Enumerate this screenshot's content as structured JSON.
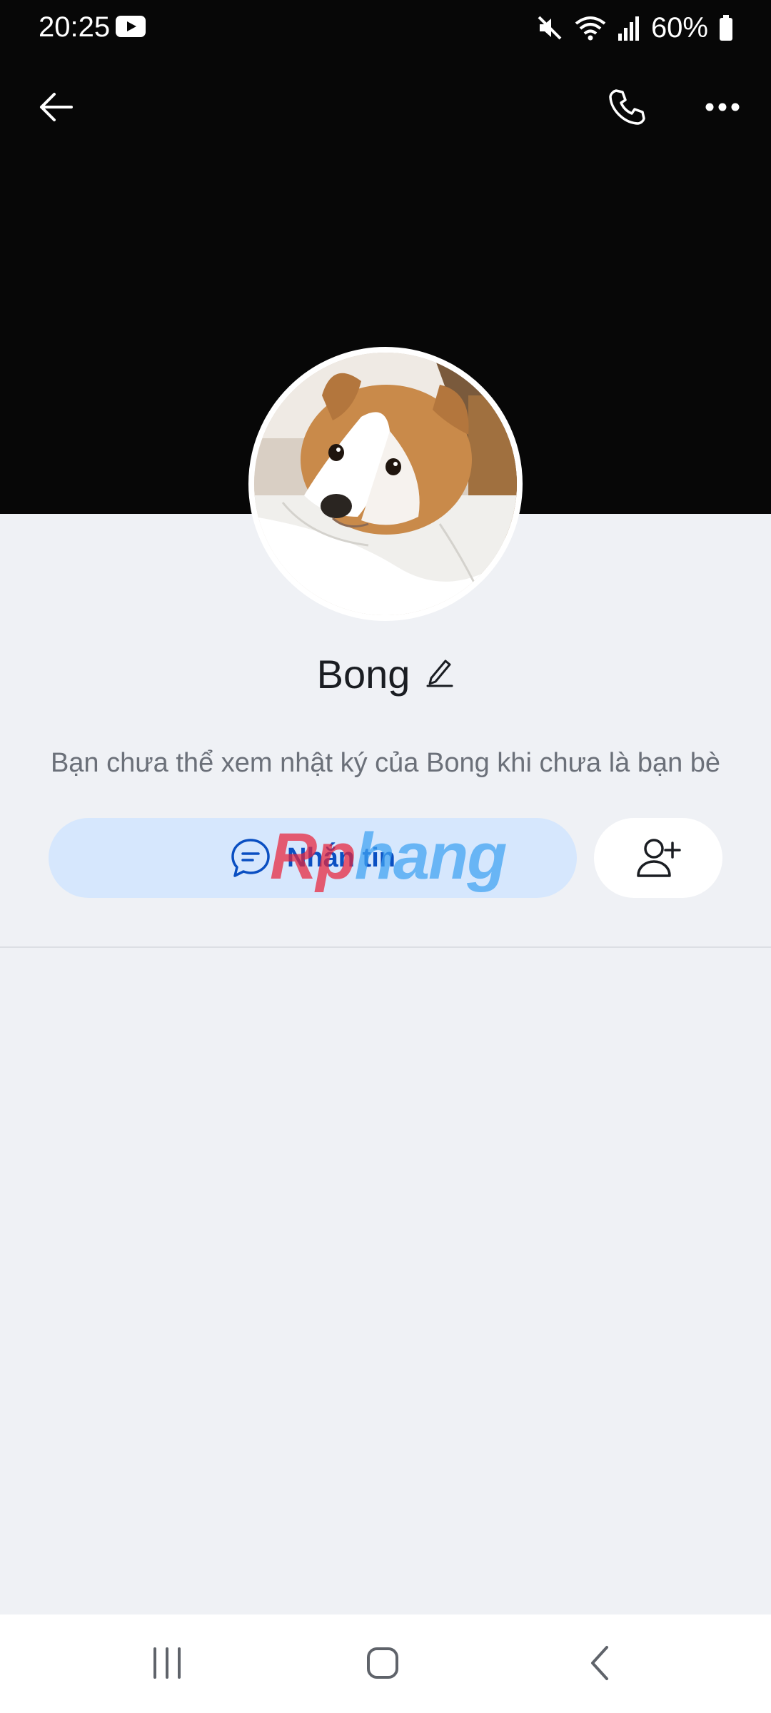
{
  "status_bar": {
    "time": "20:25",
    "battery": "60%",
    "icons": [
      "youtube-icon",
      "mute-icon",
      "wifi-icon",
      "signal-icon",
      "battery-icon"
    ]
  },
  "top_bar": {
    "icons": [
      "back-arrow-icon",
      "phone-icon",
      "more-icon"
    ]
  },
  "profile": {
    "name": "Bong",
    "notice": "Bạn chưa thể xem nhật ký của Bong khi chưa là bạn bè"
  },
  "actions": {
    "message_label": "Nhắn tin",
    "message_icon": "chat-bubble-icon",
    "add_friend_icon": "add-friend-icon"
  },
  "watermark": {
    "part1": "Rp",
    "part2": "hang"
  },
  "colors": {
    "accent": "#0a4fc2",
    "message_button_bg": "#d6e7fd",
    "background": "#eff1f5",
    "cover": "#070707"
  },
  "nav_bar": {
    "icons": [
      "recent-apps-icon",
      "home-icon",
      "system-back-icon"
    ]
  }
}
